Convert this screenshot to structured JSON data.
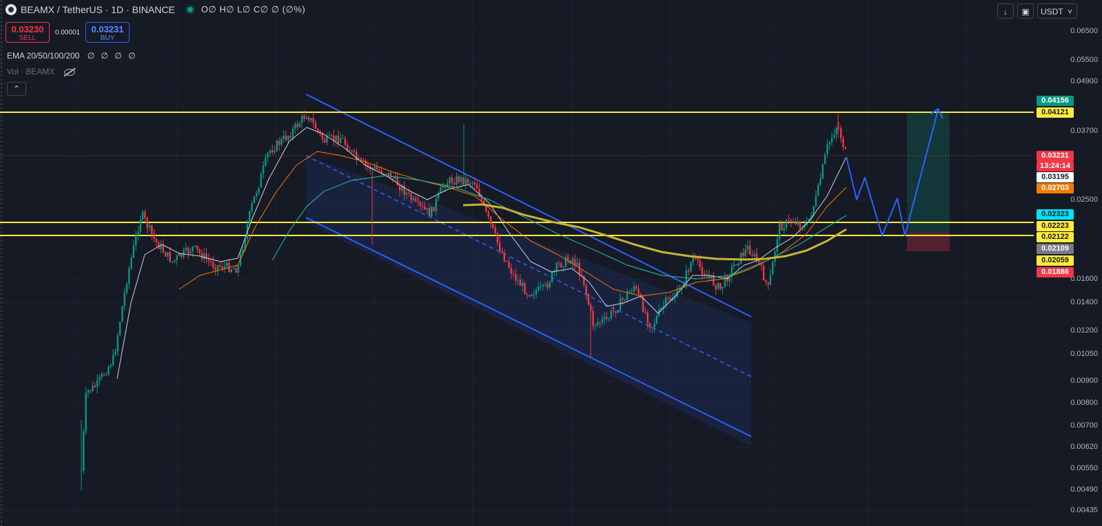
{
  "header": {
    "symbol": "BEAMX / TetherUS · 1D · BINANCE",
    "ohlc": "O∅ H∅ L∅ C∅ ∅ (∅%)"
  },
  "trade": {
    "sell_price": "0.03230",
    "sell_label": "SELL",
    "spread": "0.00001",
    "buy_price": "0.03231",
    "buy_label": "BUY"
  },
  "indicators": {
    "ema_label": "EMA 20/50/100/200",
    "ema_values": "∅ ∅ ∅ ∅",
    "vol_label": "Vol · BEAMX"
  },
  "toolbar": {
    "currency": "USDT"
  },
  "price_axis": {
    "ticks": [
      "0.06500",
      "0.05500",
      "0.04900",
      "0.03700",
      "0.02500",
      "0.01600",
      "0.01400",
      "0.01200",
      "0.01050",
      "0.00900",
      "0.00800",
      "0.00700",
      "0.00620",
      "0.00550",
      "0.00490",
      "0.00435"
    ]
  },
  "price_badges": [
    {
      "text": "0.04156",
      "bg": "#089981",
      "fg": "#ffffff"
    },
    {
      "text": "0.04121",
      "bg": "#ffeb3b",
      "fg": "#131722"
    },
    {
      "text": "0.03231",
      "bg": "#f23645",
      "fg": "#ffffff"
    },
    {
      "text": "13:24:14",
      "bg": "#f23645",
      "fg": "#ffffff"
    },
    {
      "text": "0.03195",
      "bg": "#ffffff",
      "fg": "#131722"
    },
    {
      "text": "0.02703",
      "bg": "#f57c00",
      "fg": "#ffffff"
    },
    {
      "text": "0.02323",
      "bg": "#00e5ff",
      "fg": "#131722"
    },
    {
      "text": "0.02223",
      "bg": "#ffeb3b",
      "fg": "#131722"
    },
    {
      "text": "0.02122",
      "bg": "#ffeb3b",
      "fg": "#131722"
    },
    {
      "text": "0.02109",
      "bg": "#787b86",
      "fg": "#ffffff"
    },
    {
      "text": "0.02059",
      "bg": "#ffeb3b",
      "fg": "#131722"
    },
    {
      "text": "0.01886",
      "bg": "#f23645",
      "fg": "#ffffff"
    }
  ],
  "colors": {
    "background": "#161a25",
    "up": "#089981",
    "down": "#f23645",
    "support_resistance": "#ffeb3b",
    "channel": "#2962ff"
  }
}
